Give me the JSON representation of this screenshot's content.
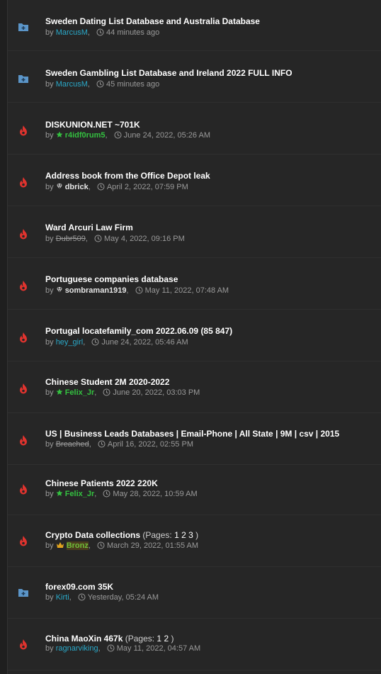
{
  "colors": {
    "background": "#262626",
    "title": "#ffffff",
    "meta": "#9a9a9a",
    "author_blue": "#2aa9c9",
    "author_green": "#34c140",
    "hot_icon": "#e0332e",
    "folder_icon": "#5b95c8"
  },
  "threads": [
    {
      "title": "Sweden Dating List Database and Australia Database",
      "pages_label": "",
      "pages": [],
      "by": "by",
      "author": "MarcusM",
      "time": "44 minutes ago",
      "icon": "folder-icon"
    },
    {
      "title": "Sweden Gambling List Database and Ireland 2022 FULL INFO",
      "pages_label": "",
      "pages": [],
      "by": "by",
      "author": "MarcusM",
      "time": "45 minutes ago",
      "icon": "folder-icon"
    },
    {
      "title": "DISKUNION.NET ~701K",
      "pages_label": "",
      "pages": [],
      "by": "by",
      "author": "r4idf0rum5",
      "time": "June 24, 2022, 05:26 AM",
      "icon": "fire-icon"
    },
    {
      "title": "Address book from the Office Depot leak",
      "pages_label": "",
      "pages": [],
      "by": "by",
      "author": "dbrick",
      "time": "April 2, 2022, 07:59 PM",
      "icon": "fire-icon"
    },
    {
      "title": "Ward Arcuri Law Firm",
      "pages_label": "",
      "pages": [],
      "by": "by",
      "author": "Dubr509",
      "time": "May 4, 2022, 09:16 PM",
      "icon": "fire-icon"
    },
    {
      "title": "Portuguese companies database",
      "pages_label": "",
      "pages": [],
      "by": "by",
      "author": "sombraman1919",
      "time": "May 11, 2022, 07:48 AM",
      "icon": "fire-icon"
    },
    {
      "title": "Portugal locatefamily_com 2022.06.09 (85 847)",
      "pages_label": "",
      "pages": [],
      "by": "by",
      "author": "hey_girl",
      "time": "June 24, 2022, 05:46 AM",
      "icon": "fire-icon"
    },
    {
      "title": "Chinese Student 2M 2020-2022",
      "pages_label": "",
      "pages": [],
      "by": "by",
      "author": "Felix_Jr",
      "time": "June 20, 2022, 03:03 PM",
      "icon": "fire-icon"
    },
    {
      "title": "US | Business Leads Databases | Email-Phone | All State | 9M | csv | 2015",
      "pages_label": "",
      "pages": [],
      "by": "by",
      "author": "Breached",
      "time": "April 16, 2022, 02:55 PM",
      "icon": "fire-icon"
    },
    {
      "title": "Chinese Patients 2022 220K",
      "pages_label": "",
      "pages": [],
      "by": "by",
      "author": "Felix_Jr",
      "time": "May 28, 2022, 10:59 AM",
      "icon": "fire-icon"
    },
    {
      "title": "Crypto Data collections",
      "pages_label": "(Pages:",
      "pages": [
        "1",
        "2",
        "3"
      ],
      "by": "by",
      "author": "Bronz",
      "time": "March 29, 2022, 01:55 AM",
      "icon": "fire-icon"
    },
    {
      "title": "forex09.com 35K",
      "pages_label": "",
      "pages": [],
      "by": "by",
      "author": "Kirti",
      "time": "Yesterday, 05:24 AM",
      "icon": "folder-icon"
    },
    {
      "title": "China MaoXin 467k",
      "pages_label": "(Pages:",
      "pages": [
        "1",
        "2"
      ],
      "by": "by",
      "author": "ragnarviking",
      "time": "May 11, 2022, 04:57 AM",
      "icon": "fire-icon"
    }
  ]
}
